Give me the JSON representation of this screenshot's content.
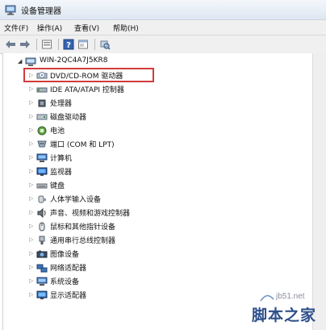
{
  "window": {
    "title": "设备管理器"
  },
  "menu": [
    {
      "label": "文件(F)"
    },
    {
      "label": "操作(A)"
    },
    {
      "label": "查看(V)"
    },
    {
      "label": "帮助(H)"
    }
  ],
  "toolbar": {
    "buttons": [
      "back-arrow-icon",
      "forward-arrow-icon",
      "properties-icon",
      "help-icon",
      "console-icon",
      "scan-hardware-icon"
    ]
  },
  "tree": {
    "root": {
      "label": "WIN-2QC4A7J5KR8"
    },
    "items": [
      {
        "label": "DVD/CD-ROM 驱动器",
        "icon": "dvd-drive-icon"
      },
      {
        "label": "IDE ATA/ATAPI 控制器",
        "icon": "ide-controller-icon"
      },
      {
        "label": "处理器",
        "icon": "processor-icon"
      },
      {
        "label": "磁盘驱动器",
        "icon": "disk-drive-icon"
      },
      {
        "label": "电池",
        "icon": "battery-icon"
      },
      {
        "label": "端口 (COM 和 LPT)",
        "icon": "port-icon"
      },
      {
        "label": "计算机",
        "icon": "computer-icon"
      },
      {
        "label": "监视器",
        "icon": "monitor-icon"
      },
      {
        "label": "键盘",
        "icon": "keyboard-icon"
      },
      {
        "label": "人体学输入设备",
        "icon": "hid-icon"
      },
      {
        "label": "声音、视频和游戏控制器",
        "icon": "sound-icon"
      },
      {
        "label": "鼠标和其他指针设备",
        "icon": "mouse-icon"
      },
      {
        "label": "通用串行总线控制器",
        "icon": "usb-icon"
      },
      {
        "label": "图像设备",
        "icon": "imaging-device-icon"
      },
      {
        "label": "网络适配器",
        "icon": "network-adapter-icon"
      },
      {
        "label": "系统设备",
        "icon": "system-device-icon"
      },
      {
        "label": "显示适配器",
        "icon": "display-adapter-icon"
      }
    ]
  },
  "watermark": {
    "url": "jb51.net",
    "name": "脚本之家"
  }
}
